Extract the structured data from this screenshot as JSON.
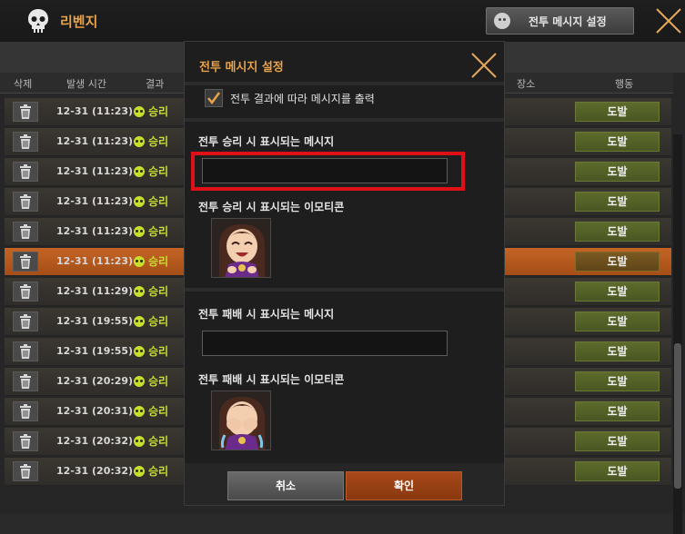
{
  "app": {
    "title": "리벤지",
    "top_button_label": "전투 메시지 설정"
  },
  "table": {
    "headers": [
      "삭제",
      "발생 시간",
      "결과",
      "장소",
      "행동"
    ],
    "rows": [
      {
        "time": "12-31 (11:23)",
        "result": "승리",
        "faint": "",
        "action": "도발",
        "selected": false
      },
      {
        "time": "12-31 (11:23)",
        "result": "승리",
        "faint": "",
        "action": "도발",
        "selected": false
      },
      {
        "time": "12-31 (11:23)",
        "result": "승리",
        "faint": "",
        "action": "도발",
        "selected": false
      },
      {
        "time": "12-31 (11:23)",
        "result": "승리",
        "faint": "",
        "action": "도발",
        "selected": false
      },
      {
        "time": "12-31 (11:23)",
        "result": "승리",
        "faint": "",
        "action": "도발",
        "selected": false
      },
      {
        "time": "12-31 (11:23)",
        "result": "승리",
        "faint": "",
        "action": "도발",
        "selected": true
      },
      {
        "time": "12-31 (11:29)",
        "result": "승리",
        "faint": "",
        "action": "도발",
        "selected": false
      },
      {
        "time": "12-31 (19:55)",
        "result": "승리",
        "faint": "",
        "action": "도발",
        "selected": false
      },
      {
        "time": "12-31 (19:55)",
        "result": "승리",
        "faint": "",
        "action": "도발",
        "selected": false
      },
      {
        "time": "12-31 (20:29)",
        "result": "승리",
        "faint": "",
        "action": "도발",
        "selected": false
      },
      {
        "time": "12-31 (20:31)",
        "result": "승리",
        "faint": "",
        "action": "도발",
        "selected": false
      },
      {
        "time": "12-31 (20:32)",
        "result": "승리",
        "faint": "",
        "action": "도발",
        "selected": false
      },
      {
        "time": "12-31 (20:32)",
        "result": "승리",
        "faint": "",
        "action": "도발",
        "selected": false
      }
    ]
  },
  "modal": {
    "title": "전투 메시지 설정",
    "checkbox_label": "전투 결과에 따라 메시지를 출력",
    "checkbox_checked": true,
    "win_message_label": "전투 승리 시 표시되는 메시지",
    "win_message_value": "",
    "win_emoticon_label": "전투 승리 시 표시되는 이모티콘",
    "lose_message_label": "전투 패배 시 표시되는 메시지",
    "lose_message_value": "",
    "lose_emoticon_label": "전투 패배 시 표시되는 이모티콘",
    "cancel_label": "취소",
    "ok_label": "확인"
  },
  "colors": {
    "accent": "#e8a24a",
    "win": "#c8df2e",
    "selected_row": "#c46425",
    "highlight": "#e01019",
    "ok_button": "#a8481a"
  }
}
